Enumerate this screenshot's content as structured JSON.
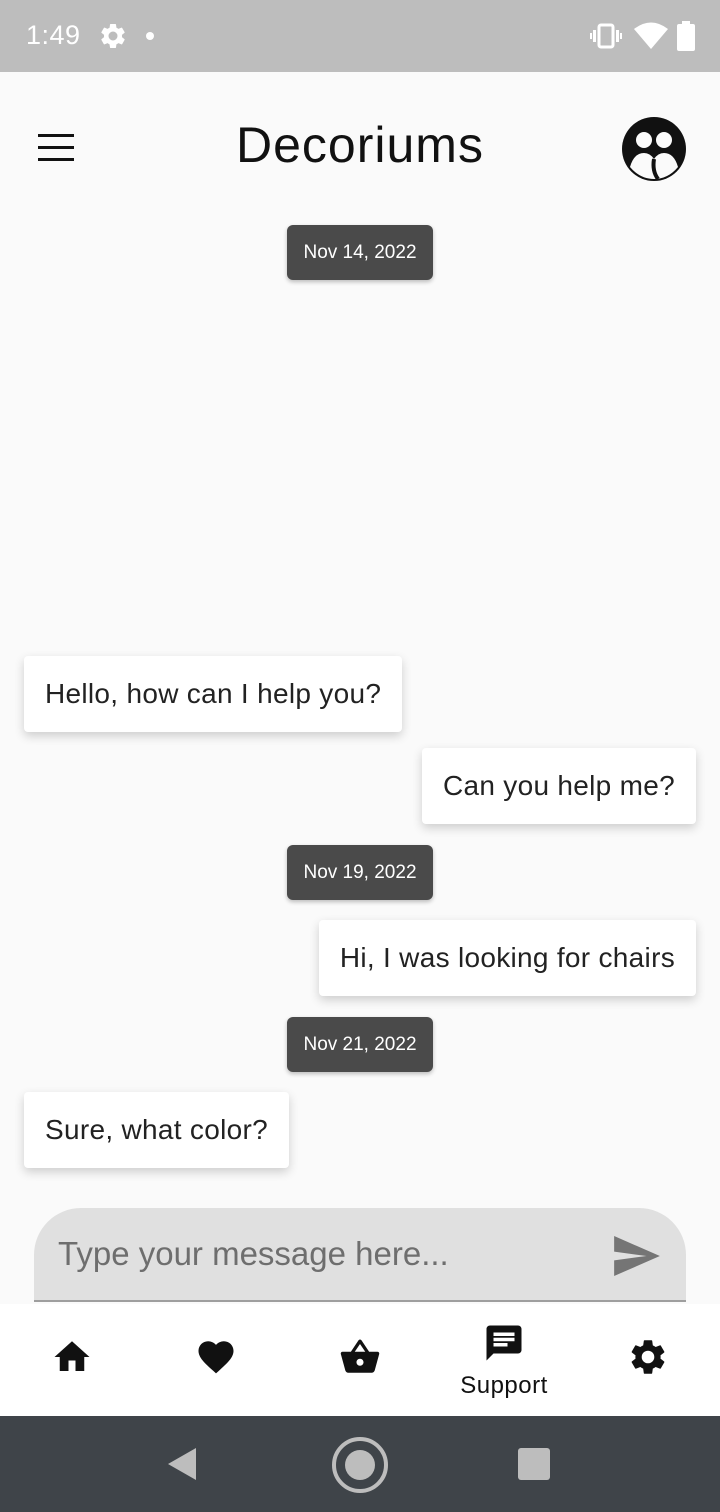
{
  "status_bar": {
    "time": "1:49",
    "icons": [
      "settings-icon",
      "notification-dot-icon",
      "vibrate-icon",
      "wifi-icon",
      "battery-icon"
    ]
  },
  "app_bar": {
    "title": "Decoriums",
    "menu_icon": "menu-icon",
    "avatar_icon": "avatar-icon"
  },
  "chat": {
    "items": [
      {
        "kind": "date",
        "text": "Nov 14, 2022"
      },
      {
        "kind": "message",
        "from": "agent",
        "text": "Hello, how can I help you?"
      },
      {
        "kind": "message",
        "from": "user",
        "text": "Can you help me?"
      },
      {
        "kind": "date",
        "text": "Nov 19, 2022"
      },
      {
        "kind": "message",
        "from": "user",
        "text": "Hi, I was looking for chairs"
      },
      {
        "kind": "date",
        "text": "Nov 21, 2022"
      },
      {
        "kind": "message",
        "from": "agent",
        "text": "Sure, what color?"
      }
    ]
  },
  "composer": {
    "placeholder": "Type your message here...",
    "value": "",
    "send_icon": "send-icon"
  },
  "bottom_nav": {
    "items": [
      {
        "id": "home",
        "icon": "home-icon",
        "label": "",
        "selected": false
      },
      {
        "id": "favorites",
        "icon": "heart-icon",
        "label": "",
        "selected": false
      },
      {
        "id": "basket",
        "icon": "basket-icon",
        "label": "",
        "selected": false
      },
      {
        "id": "support",
        "icon": "chat-icon",
        "label": "Support",
        "selected": true
      },
      {
        "id": "settings",
        "icon": "gear-icon",
        "label": "",
        "selected": false
      }
    ]
  },
  "system_nav": {
    "icons": [
      "back-icon",
      "home-circle-icon",
      "recents-icon"
    ]
  },
  "colors": {
    "status_bar": "#bdbdbd",
    "date_chip": "#4a4a4a",
    "bubble": "#ffffff",
    "background": "#fafafa",
    "input": "#e0e0e0",
    "system_nav": "#3f4449"
  }
}
